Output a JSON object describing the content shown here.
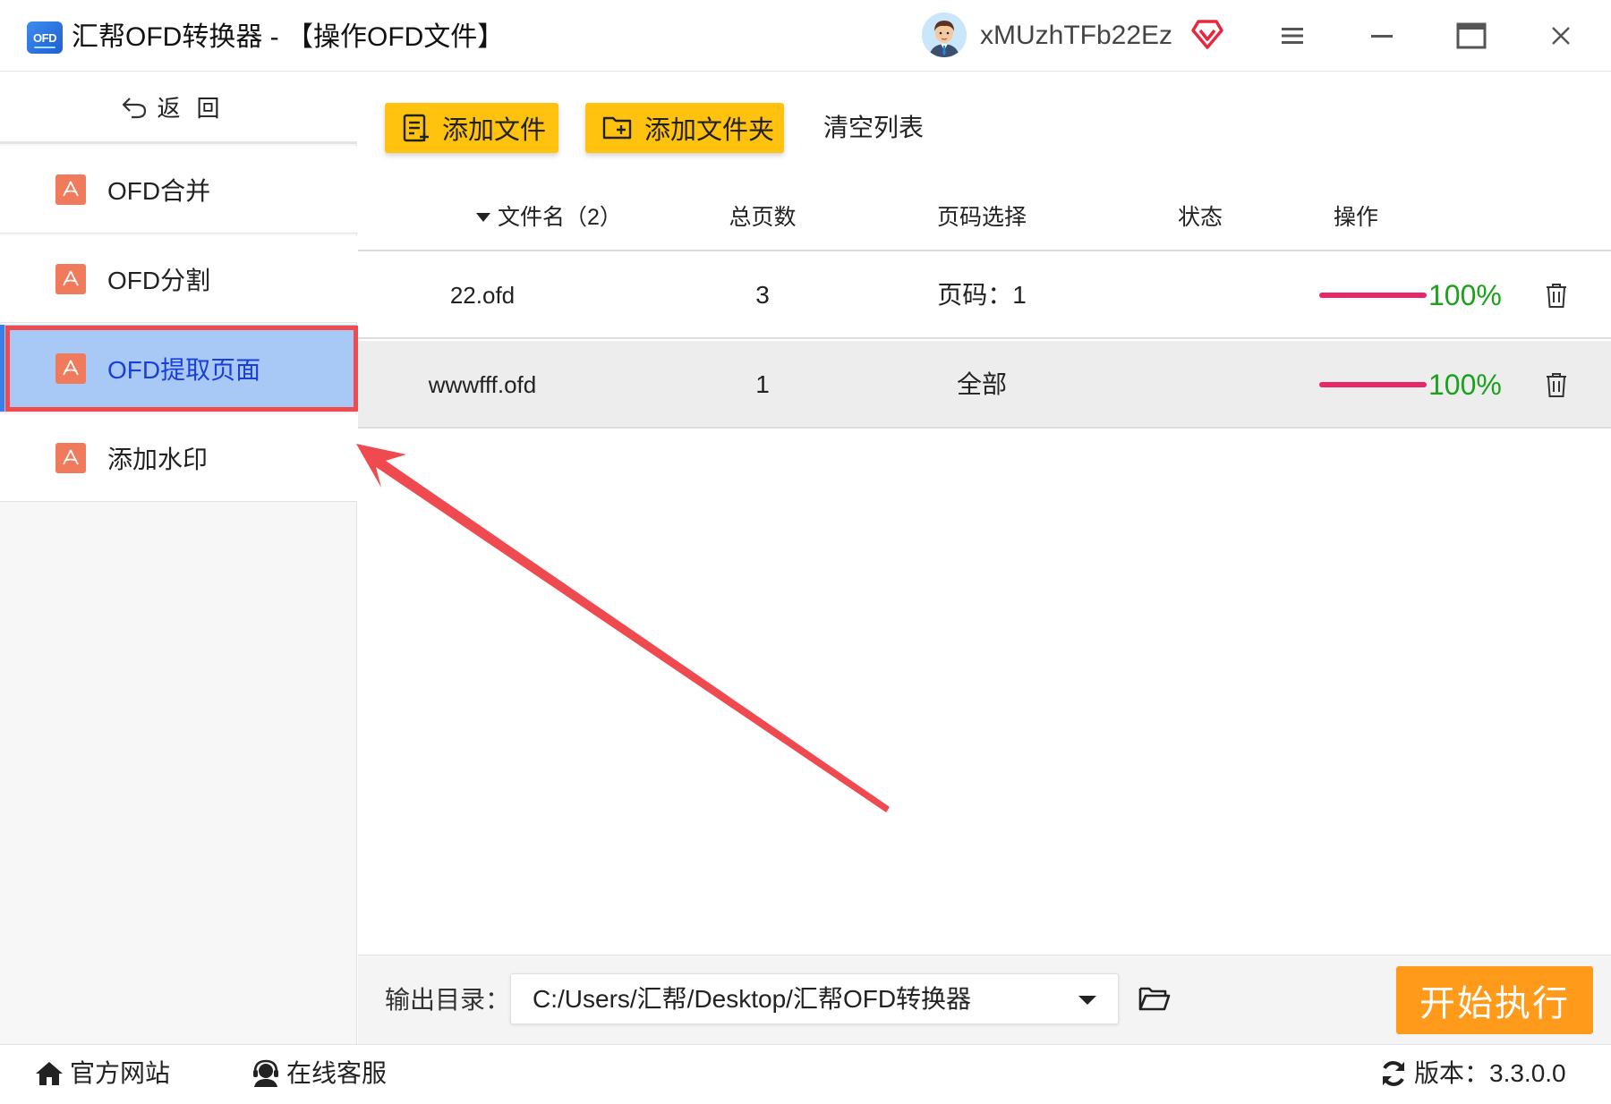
{
  "app": {
    "logo_text": "OFD",
    "title": "汇帮OFD转换器 - 【操作OFD文件】",
    "username": "xMUzhTFb22Ez"
  },
  "window_controls": {
    "menu_icon": "hamburger-menu-icon",
    "minimize_icon": "minimize-icon",
    "maximize_icon": "maximize-icon",
    "close_icon": "close-icon"
  },
  "sidebar": {
    "back_label": "返回",
    "items": [
      {
        "label": "OFD合并",
        "icon": "pdf-icon",
        "active": false
      },
      {
        "label": "OFD分割",
        "icon": "pdf-icon",
        "active": false
      },
      {
        "label": "OFD提取页面",
        "icon": "pdf-icon",
        "active": true
      },
      {
        "label": "添加水印",
        "icon": "pdf-icon",
        "active": false
      }
    ]
  },
  "toolbar": {
    "add_file_label": "添加文件",
    "add_folder_label": "添加文件夹",
    "clear_list_label": "清空列表"
  },
  "table": {
    "headers": {
      "filename": "文件名（2）",
      "total_pages": "总页数",
      "page_select": "页码选择",
      "status": "状态",
      "action": "操作"
    },
    "rows": [
      {
        "filename": "22.ofd",
        "total_pages": "3",
        "page_select": "页码：1",
        "progress": 100,
        "progress_text": "100%"
      },
      {
        "filename": "wwwfff.ofd",
        "total_pages": "1",
        "page_select": "全部",
        "progress": 100,
        "progress_text": "100%"
      }
    ]
  },
  "output": {
    "label": "输出目录：",
    "path": "C:/Users/汇帮/Desktop/汇帮OFD转换器",
    "start_label": "开始执行"
  },
  "footer": {
    "website_label": "官方网站",
    "support_label": "在线客服",
    "version_label": "版本：3.3.0.0"
  },
  "colors": {
    "accent_blue": "#3a7ee6",
    "active_bg": "#a8c9f6",
    "button_yellow": "#ffc20f",
    "start_orange": "#ff9a1a",
    "progress_red": "#e8276a",
    "progress_text_green": "#1aa21a",
    "annotation_red": "#ee4a50"
  }
}
